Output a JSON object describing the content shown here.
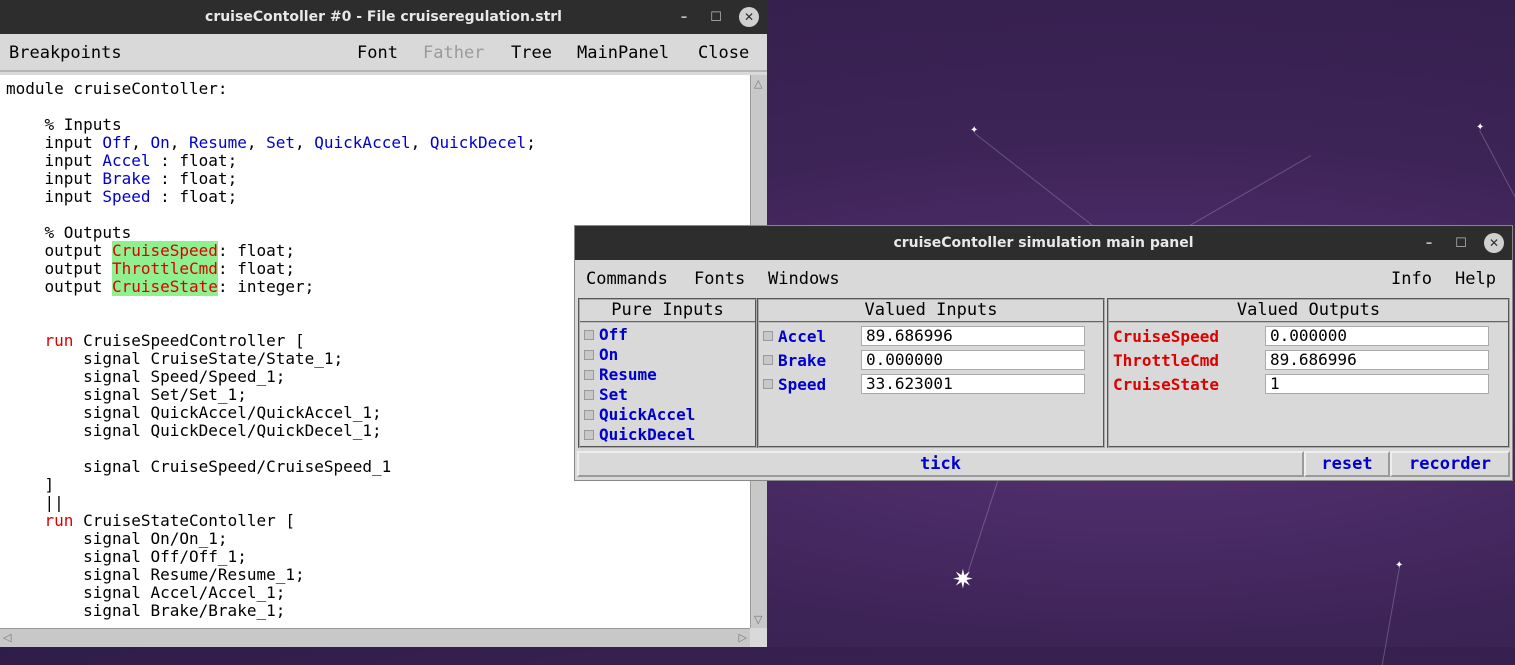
{
  "editor": {
    "title": "cruiseContoller  #0 - File cruiseregulation.strl",
    "menu": {
      "breakpoints": "Breakpoints",
      "font": "Font",
      "father": "Father",
      "tree": "Tree",
      "mainpanel": "MainPanel",
      "close": "Close"
    },
    "code": {
      "l1": "module cruiseContoller:",
      "c_inputs": "    % Inputs",
      "in1_a": "    input ",
      "in1_off": "Off",
      "sep": ", ",
      "in1_on": "On",
      "in1_resume": "Resume",
      "in1_set": "Set",
      "in1_qa": "QuickAccel",
      "in1_qd": "QuickDecel",
      "semi": ";",
      "in2_a": "    input ",
      "in2_n": "Accel",
      "in2_b": " : float;",
      "in3_n": "Brake",
      "in4_n": "Speed",
      "c_outputs": "    % Outputs",
      "out_a": "    output ",
      "out1_n": "CruiseSpeed",
      "out1_b": ": float;",
      "out2_n": "ThrottleCmd",
      "out2_b": ": float;",
      "out3_n": "CruiseState",
      "out3_b": ": integer;",
      "run_kw": "run",
      "run1_b": " CruiseSpeedController [",
      "s1": "        signal CruiseState/State_1;",
      "s2": "        signal Speed/Speed_1;",
      "s3": "        signal Set/Set_1;",
      "s4": "        signal QuickAccel/QuickAccel_1;",
      "s5": "        signal QuickDecel/QuickDecel_1;",
      "s6": "        signal CruiseSpeed/CruiseSpeed_1",
      "close_br": "    ]",
      "par": "    ||",
      "run2_b": " CruiseStateContoller [",
      "t1": "        signal On/On_1;",
      "t2": "        signal Off/Off_1;",
      "t3": "        signal Resume/Resume_1;",
      "t4": "        signal Accel/Accel_1;",
      "t5": "        signal Brake/Brake_1;"
    }
  },
  "panel": {
    "title": "cruiseContoller simulation main panel",
    "menu": {
      "commands": "Commands",
      "fonts": "Fonts",
      "windows": "Windows",
      "info": "Info",
      "help": "Help"
    },
    "pure_inputs": {
      "header": "Pure Inputs",
      "items": [
        "Off",
        "On",
        "Resume",
        "Set",
        "QuickAccel",
        "QuickDecel"
      ]
    },
    "valued_inputs": {
      "header": "Valued Inputs",
      "rows": [
        {
          "label": "Accel",
          "value": "89.686996"
        },
        {
          "label": "Brake",
          "value": "0.000000"
        },
        {
          "label": "Speed",
          "value": "33.623001"
        }
      ]
    },
    "valued_outputs": {
      "header": "Valued Outputs",
      "rows": [
        {
          "label": "CruiseSpeed",
          "value": "0.000000"
        },
        {
          "label": "ThrottleCmd",
          "value": "89.686996"
        },
        {
          "label": "CruiseState",
          "value": "1"
        }
      ]
    },
    "buttons": {
      "tick": "tick",
      "reset": "reset",
      "recorder": "recorder"
    }
  },
  "colors": {
    "keyword": "#0000cc",
    "output": "#dd0000",
    "highlight": "#8ef08e",
    "desktop": "#3d2457"
  }
}
